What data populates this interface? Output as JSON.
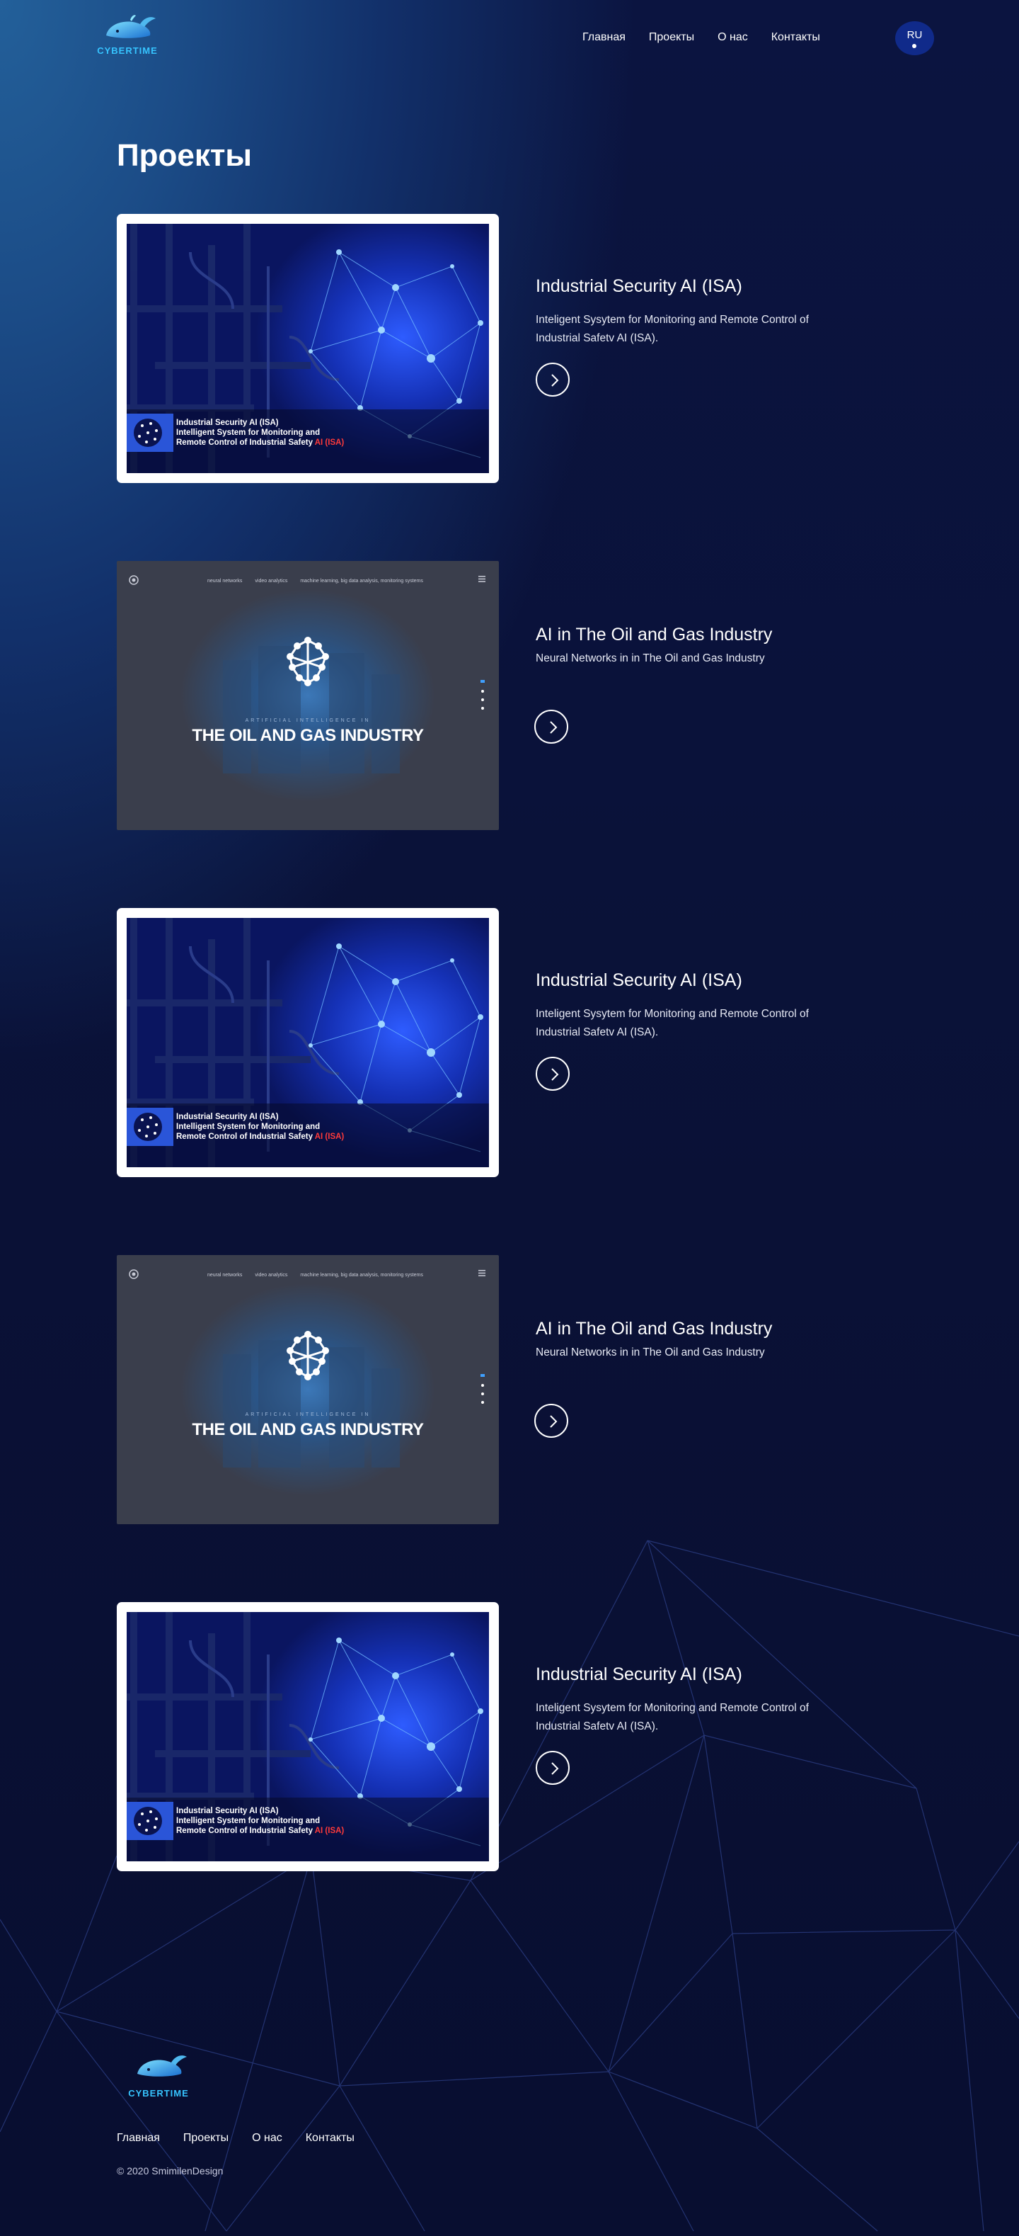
{
  "header": {
    "logo_text": "CYBERTIME",
    "nav": [
      "Главная",
      "Проекты",
      "О нас",
      "Контакты"
    ],
    "lang": "RU"
  },
  "page_title": "Проекты",
  "projects": [
    {
      "kind": "isa",
      "title": "Industrial Security AI (ISA)",
      "description": "Inteligent Sysytem for Monitoring and Remote Control of Industrial Safetv AI (ISA).",
      "thumb_lines": [
        "Industrial Security AI (ISA)",
        "Intelligent System for Monitoring and",
        "Remote Control of Industrial Safety "
      ],
      "thumb_highlight": "AI (ISA)",
      "arrow_icon": "chevron-right-icon"
    },
    {
      "kind": "oil",
      "title": "AI in The Oil and Gas Industry",
      "description": "Neural Networks in in The Oil and Gas Industry",
      "thumb_nav": [
        "neural networks",
        "video analytics",
        "machine learning, big data analysis, monitoring systems"
      ],
      "thumb_subtitle": "ARTIFICIAL INTELLIGENCE IN",
      "thumb_title": "THE OIL AND GAS INDUSTRY",
      "arrow_icon": "chevron-right-icon"
    },
    {
      "kind": "isa",
      "title": "Industrial Security AI (ISA)",
      "description": "Inteligent Sysytem for Monitoring and Remote Control of Industrial Safetv AI (ISA).",
      "thumb_lines": [
        "Industrial Security AI (ISA)",
        "Intelligent System for Monitoring and",
        "Remote Control of Industrial Safety "
      ],
      "thumb_highlight": "AI (ISA)",
      "arrow_icon": "chevron-right-icon"
    },
    {
      "kind": "oil",
      "title": "AI in The Oil and Gas Industry",
      "description": "Neural Networks in in The Oil and Gas Industry",
      "thumb_nav": [
        "neural networks",
        "video analytics",
        "machine learning, big data analysis, monitoring systems"
      ],
      "thumb_subtitle": "ARTIFICIAL INTELLIGENCE IN",
      "thumb_title": "THE OIL AND GAS INDUSTRY",
      "arrow_icon": "chevron-right-icon"
    },
    {
      "kind": "isa",
      "title": "Industrial Security AI (ISA)",
      "description": "Inteligent Sysytem for Monitoring and Remote Control of Industrial Safetv AI (ISA).",
      "thumb_lines": [
        "Industrial Security AI (ISA)",
        "Intelligent System for Monitoring and",
        "Remote Control of Industrial Safety "
      ],
      "thumb_highlight": "AI (ISA)",
      "arrow_icon": "chevron-right-icon"
    }
  ],
  "footer": {
    "logo_text": "CYBERTIME",
    "nav": [
      "Главная",
      "Проекты",
      "О нас",
      "Контакты"
    ],
    "copyright": "© 2020 SmimilenDesign"
  },
  "colors": {
    "accent": "#2a55d8",
    "lang_bg": "#102a8a",
    "highlight_red": "#ff3a3a",
    "logo_cyan": "#36c4ff"
  }
}
